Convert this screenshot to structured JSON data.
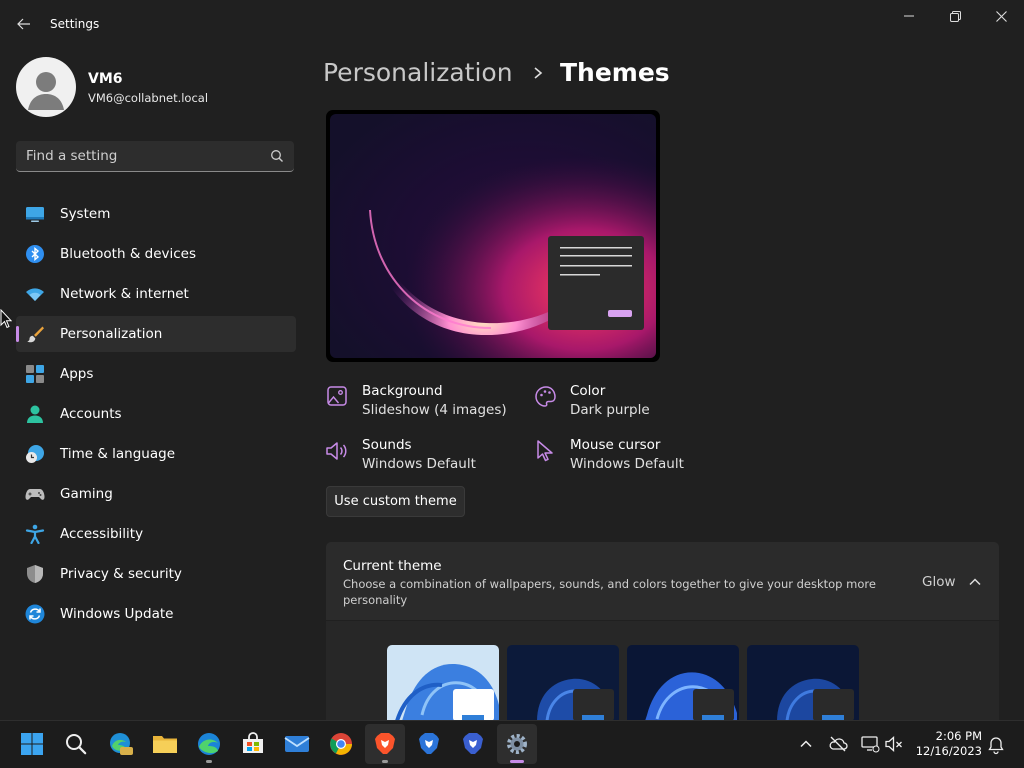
{
  "window": {
    "title": "Settings"
  },
  "user": {
    "name": "VM6",
    "email": "VM6@collabnet.local"
  },
  "search": {
    "placeholder": "Find a setting"
  },
  "nav": {
    "items": [
      {
        "label": "System",
        "icon": "system-icon"
      },
      {
        "label": "Bluetooth & devices",
        "icon": "bluetooth-icon"
      },
      {
        "label": "Network & internet",
        "icon": "wifi-icon"
      },
      {
        "label": "Personalization",
        "icon": "brush-icon",
        "selected": true
      },
      {
        "label": "Apps",
        "icon": "apps-icon"
      },
      {
        "label": "Accounts",
        "icon": "accounts-icon"
      },
      {
        "label": "Time & language",
        "icon": "clock-globe-icon"
      },
      {
        "label": "Gaming",
        "icon": "gamepad-icon"
      },
      {
        "label": "Accessibility",
        "icon": "accessibility-icon"
      },
      {
        "label": "Privacy & security",
        "icon": "shield-icon"
      },
      {
        "label": "Windows Update",
        "icon": "update-icon"
      }
    ]
  },
  "breadcrumb": {
    "parent": "Personalization",
    "current": "Themes"
  },
  "theme_props": {
    "background": {
      "label": "Background",
      "value": "Slideshow (4 images)",
      "icon": "picture-icon"
    },
    "color": {
      "label": "Color",
      "value": "Dark purple",
      "icon": "palette-icon"
    },
    "sounds": {
      "label": "Sounds",
      "value": "Windows Default",
      "icon": "speaker-icon"
    },
    "cursor": {
      "label": "Mouse cursor",
      "value": "Windows Default",
      "icon": "cursor-icon"
    }
  },
  "custom_theme_button": "Use custom theme",
  "current_theme": {
    "title": "Current theme",
    "description": "Choose a combination of wallpapers, sounds, and colors together to give your desktop more personality",
    "value": "Glow"
  },
  "taskbar": {
    "time": "2:06 PM",
    "date": "12/16/2023",
    "apps": [
      "start-icon",
      "search-icon",
      "edge-beta-icon",
      "file-explorer-icon",
      "edge-icon",
      "store-icon",
      "mail-icon",
      "chrome-icon",
      "brave-icon",
      "brave-beta-icon",
      "brave-nightly-icon",
      "settings-icon"
    ]
  },
  "colors": {
    "accent": "#c78be7",
    "background": "#202020",
    "panel": "#2b2b2b"
  }
}
